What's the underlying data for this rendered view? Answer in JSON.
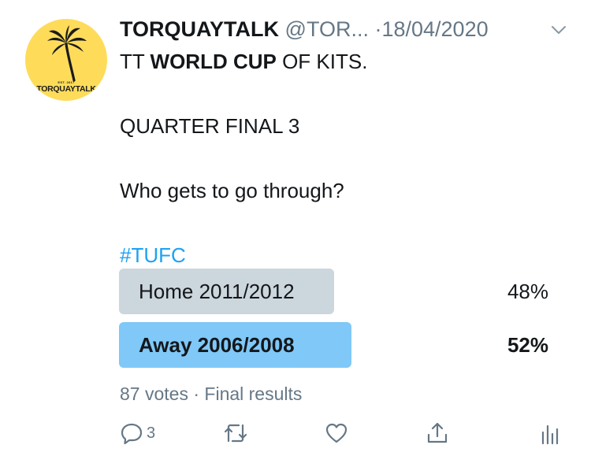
{
  "tweet": {
    "avatar": {
      "est_text": "EST. 2017",
      "name_text": "TORQUAYTALK",
      "color": "#fedc5a"
    },
    "display_name": "TORQUAYTALK",
    "handle": "@TOR...",
    "separator": "·",
    "date": "18/04/2020",
    "text": {
      "line1_prefix": "TT ",
      "line1_bold": "WORLD CUP",
      "line1_suffix": " OF KITS.",
      "line2": "QUARTER FINAL 3",
      "line3": "Who gets to go through?",
      "hashtag": "#TUFC"
    },
    "poll": {
      "options": [
        {
          "label": "Home 2011/2012",
          "percent_text": "48%",
          "percent": 48,
          "winner": false,
          "color": "#ccd6dd"
        },
        {
          "label": "Away 2006/2008",
          "percent_text": "52%",
          "percent": 52,
          "winner": true,
          "color": "#7fc8f8"
        }
      ],
      "votes": "87 votes",
      "separator": "·",
      "status": "Final results"
    },
    "actions": {
      "reply_count": "3",
      "icons": [
        "reply-icon",
        "retweet-icon",
        "like-icon",
        "share-icon",
        "analytics-icon"
      ]
    },
    "colors": {
      "text": "#14171a",
      "secondary": "#657786",
      "link": "#1da1f2"
    }
  }
}
